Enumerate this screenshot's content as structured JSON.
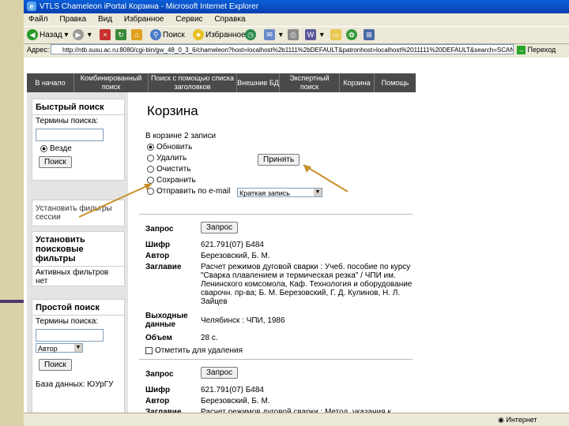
{
  "window": {
    "title": "VTLS Chameleon iPortal Корзина - Microsoft Internet Explorer"
  },
  "menu": [
    "Файл",
    "Правка",
    "Вид",
    "Избранное",
    "Сервис",
    "Справка"
  ],
  "toolbar": {
    "back": "Назад",
    "search": "Поиск",
    "favorites": "Избранное"
  },
  "address": {
    "label": "Адрес:",
    "url": "http://ntb.susu.ac.ru:8080/cgi-bin/gw_48_0_3_6/chameleon?host=localhost%2b1111%2bDEFAULT&patronhost=localhost%2011111%20DEFAULT&search=SCAN...",
    "go": "Переход"
  },
  "nav": [
    "В начало",
    "Комбинированный поиск",
    "Поиск с помощью списка заголовков",
    "Внешние БД",
    "Экспертный поиск",
    "Корзина",
    "Помощь"
  ],
  "left": {
    "quick": {
      "title": "Быстрый поиск",
      "terms": "Термины поиска:",
      "everywhere": "Везде",
      "go": "Поиск"
    },
    "session": "Установить фильтры сессии",
    "filters": {
      "title": "Установить поисковые фильтры",
      "active": "Активных фильтров нет"
    },
    "simple": {
      "title": "Простой поиск",
      "terms": "Термины поиска:",
      "select": "Автор",
      "go": "Поиск",
      "db": "База данных: ЮУрГУ"
    }
  },
  "main": {
    "title": "Корзина",
    "count": "В корзине 2 записи",
    "options": [
      "Обновить",
      "Удалить",
      "Очистить",
      "Сохранить",
      "Отправить по e-mail"
    ],
    "format": "Краткая запись",
    "apply": "Принять",
    "records": [
      {
        "req_label": "Запрос",
        "req_btn": "Запрос",
        "fields": [
          {
            "k": "Шифр",
            "v": "621.791(07) Б484"
          },
          {
            "k": "Автор",
            "v": "Березовский, Б. М."
          },
          {
            "k": "Заглавие",
            "v": "Расчет режимов дуговой сварки : Учеб. пособие по курсу \"Сварка плавлением и термическая резка\" / ЧПИ им. Ленинского комсомола, Каф. Технология и оборудование сварочн. пр-ва; Б. М. Березовский, Г. Д. Кулинов, Н. Л. Зайцев"
          },
          {
            "k": "Выходные данные",
            "v": "Челябинск : ЧПИ, 1986"
          },
          {
            "k": "Объем",
            "v": "28 с."
          }
        ],
        "mark": "Отметить для удаления"
      },
      {
        "req_label": "Запрос",
        "req_btn": "Запрос",
        "fields": [
          {
            "k": "Шифр",
            "v": "621.791(07) Б484"
          },
          {
            "k": "Автор",
            "v": "Березовский, Б. М."
          },
          {
            "k": "Заглавие",
            "v": "Расчет режимов дуговой сварки : Метод. указания к"
          }
        ]
      }
    ]
  },
  "status": {
    "zone": "Интернет"
  }
}
